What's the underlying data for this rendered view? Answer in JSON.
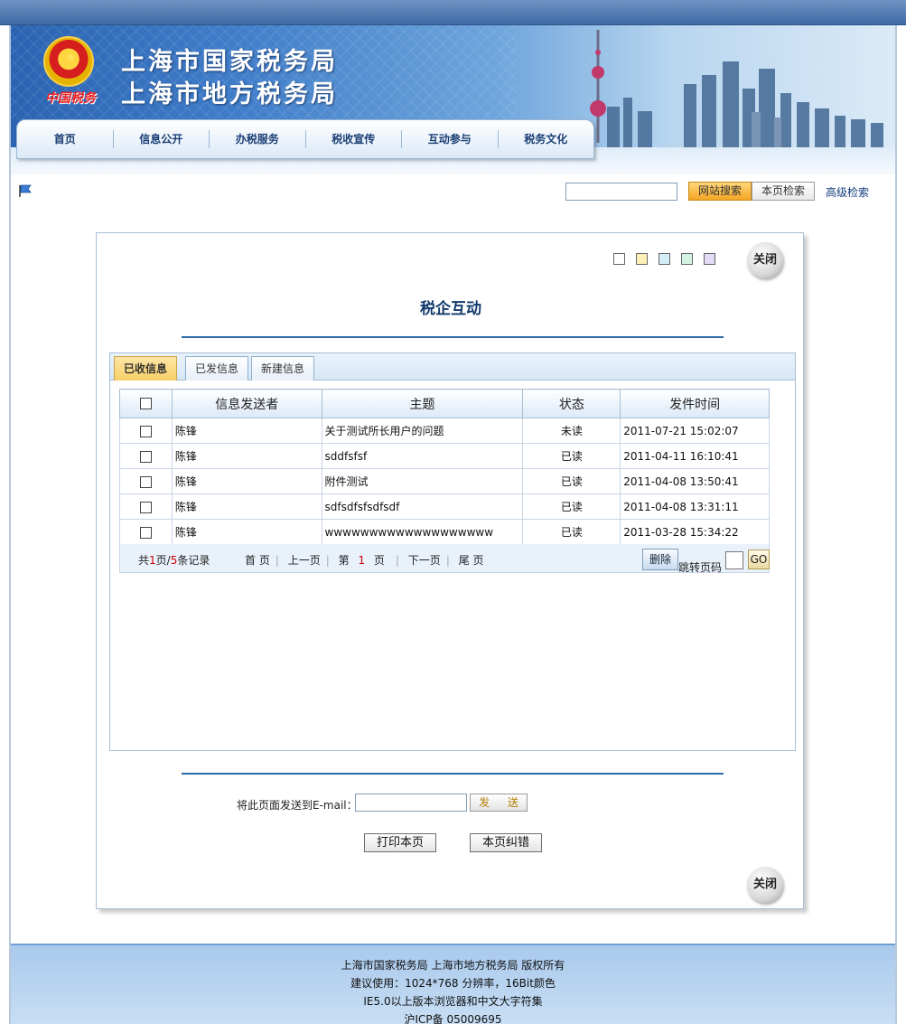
{
  "header": {
    "emblem_caption": "中国税务",
    "title_line1": "上海市国家税务局",
    "title_line2": "上海市地方税务局",
    "nav": [
      "首页",
      "信息公开",
      "办税服务",
      "税收宣传",
      "互动参与",
      "税务文化"
    ]
  },
  "search": {
    "input_value": "",
    "site_search_label": "网站搜索",
    "page_search_label": "本页检索",
    "advanced_label": "高级检索"
  },
  "panel": {
    "title": "税企互动",
    "close_label": "关闭",
    "swatch_colors": [
      "#ffffff",
      "#fdf0b8",
      "#d5edf6",
      "#d4f3e2",
      "#e2dcf6"
    ],
    "tabs": [
      "已收信息",
      "已发信息",
      "新建信息"
    ],
    "active_tab": 0,
    "table": {
      "headers": [
        "信息发送者",
        "主题",
        "状态",
        "发件时间"
      ],
      "rows": [
        {
          "sender": "陈锋",
          "subject": "关于测试所长用户的问题",
          "status": "未读",
          "time": "2011-07-21 15:02:07"
        },
        {
          "sender": "陈锋",
          "subject": "sddfsfsf",
          "status": "已读",
          "time": "2011-04-11 16:10:41"
        },
        {
          "sender": "陈锋",
          "subject": "附件测试",
          "status": "已读",
          "time": "2011-04-08 13:50:41"
        },
        {
          "sender": "陈锋",
          "subject": "sdfsdfsfsdfsdf",
          "status": "已读",
          "time": "2011-04-08 13:31:11"
        },
        {
          "sender": "陈锋",
          "subject": "wwwwwwwwwwwwwwwwwww",
          "status": "已读",
          "time": "2011-03-28 15:34:22"
        }
      ]
    },
    "pager": {
      "prefix": "共",
      "pages": "1",
      "mid": "页/",
      "records": "5",
      "suffix": "条记录",
      "first": "首 页",
      "prev": "上一页",
      "page_prefix": "第",
      "current": "1",
      "page_suffix": "页",
      "next": "下一页",
      "last": "尾 页",
      "delete_label": "删除",
      "jump_label": "跳转页码",
      "go_label": "GO"
    },
    "email": {
      "label": "将此页面发送到E-mail：",
      "value": "",
      "send_label": "发 送"
    },
    "print_label": "打印本页",
    "fix_label": "本页纠错"
  },
  "footer": {
    "line1": "上海市国家税务局  上海市地方税务局 版权所有",
    "line2": "建议使用：1024*768 分辨率，16Bit颜色",
    "line3": "IE5.0以上版本浏览器和中文大字符集",
    "line4": "沪ICP备 05009695"
  }
}
